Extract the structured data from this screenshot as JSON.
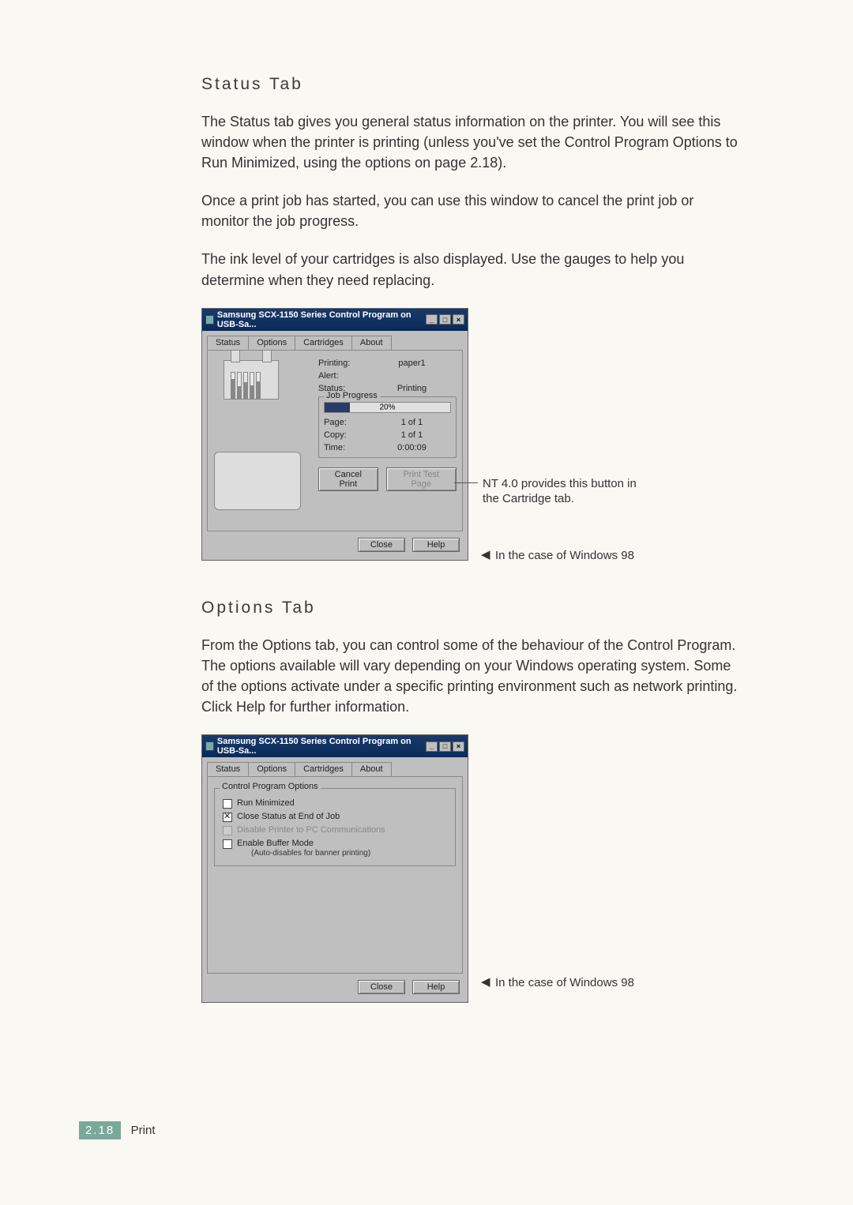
{
  "section1": {
    "heading": "Status Tab",
    "para1": "The Status tab gives you general status information on the printer. You will see this window when the printer is printing (unless you've set the Control Program Options to Run Minimized, using the options on page 2.18).",
    "para2": "Once a print job has started, you can use this window to cancel the print job or monitor the job progress.",
    "para3": "The ink level of your cartridges is also displayed. Use the gauges to help you determine when they need replacing."
  },
  "dialog1": {
    "title": "Samsung SCX-1150 Series Control Program on USB-Sa...",
    "tabs": [
      "Status",
      "Options",
      "Cartridges",
      "About"
    ],
    "active_tab": 0,
    "fields": {
      "printing_label": "Printing:",
      "printing_value": "paper1",
      "alert_label": "Alert:",
      "alert_value": "",
      "status_label": "Status:",
      "status_value": "Printing"
    },
    "progress": {
      "legend": "Job Progress",
      "percent": "20%",
      "page_label": "Page:",
      "page_value": "1 of 1",
      "copy_label": "Copy:",
      "copy_value": "1 of 1",
      "time_label": "Time:",
      "time_value": "0:00:09"
    },
    "cancel_btn": "Cancel Print",
    "test_btn": "Print Test Page",
    "close_btn": "Close",
    "help_btn": "Help"
  },
  "annot1": "NT 4.0 provides this button in the Cartridge tab.",
  "annot2": "In the case of Windows 98",
  "section2": {
    "heading": "Options Tab",
    "para1": "From the Options tab, you can control some of the behaviour of the Control Program. The options available will vary depending on your Windows operating system. Some of the options activate under a specific printing environment such as network printing. Click Help for further information."
  },
  "dialog2": {
    "title": "Samsung SCX-1150 Series Control Program on USB-Sa...",
    "tabs": [
      "Status",
      "Options",
      "Cartridges",
      "About"
    ],
    "active_tab": 1,
    "group_legend": "Control Program Options",
    "options": [
      {
        "label": "Run Minimized",
        "checked": false,
        "disabled": false
      },
      {
        "label": "Close Status at End of Job",
        "checked": true,
        "disabled": false
      },
      {
        "label": "Disable Printer to PC Communications",
        "checked": false,
        "disabled": true
      },
      {
        "label": "Enable Buffer Mode",
        "checked": false,
        "disabled": false,
        "sub": "(Auto-disables for banner printing)"
      }
    ],
    "close_btn": "Close",
    "help_btn": "Help"
  },
  "annot3": "In the case of Windows 98",
  "footer": {
    "page": "2.18",
    "section": "Print"
  }
}
